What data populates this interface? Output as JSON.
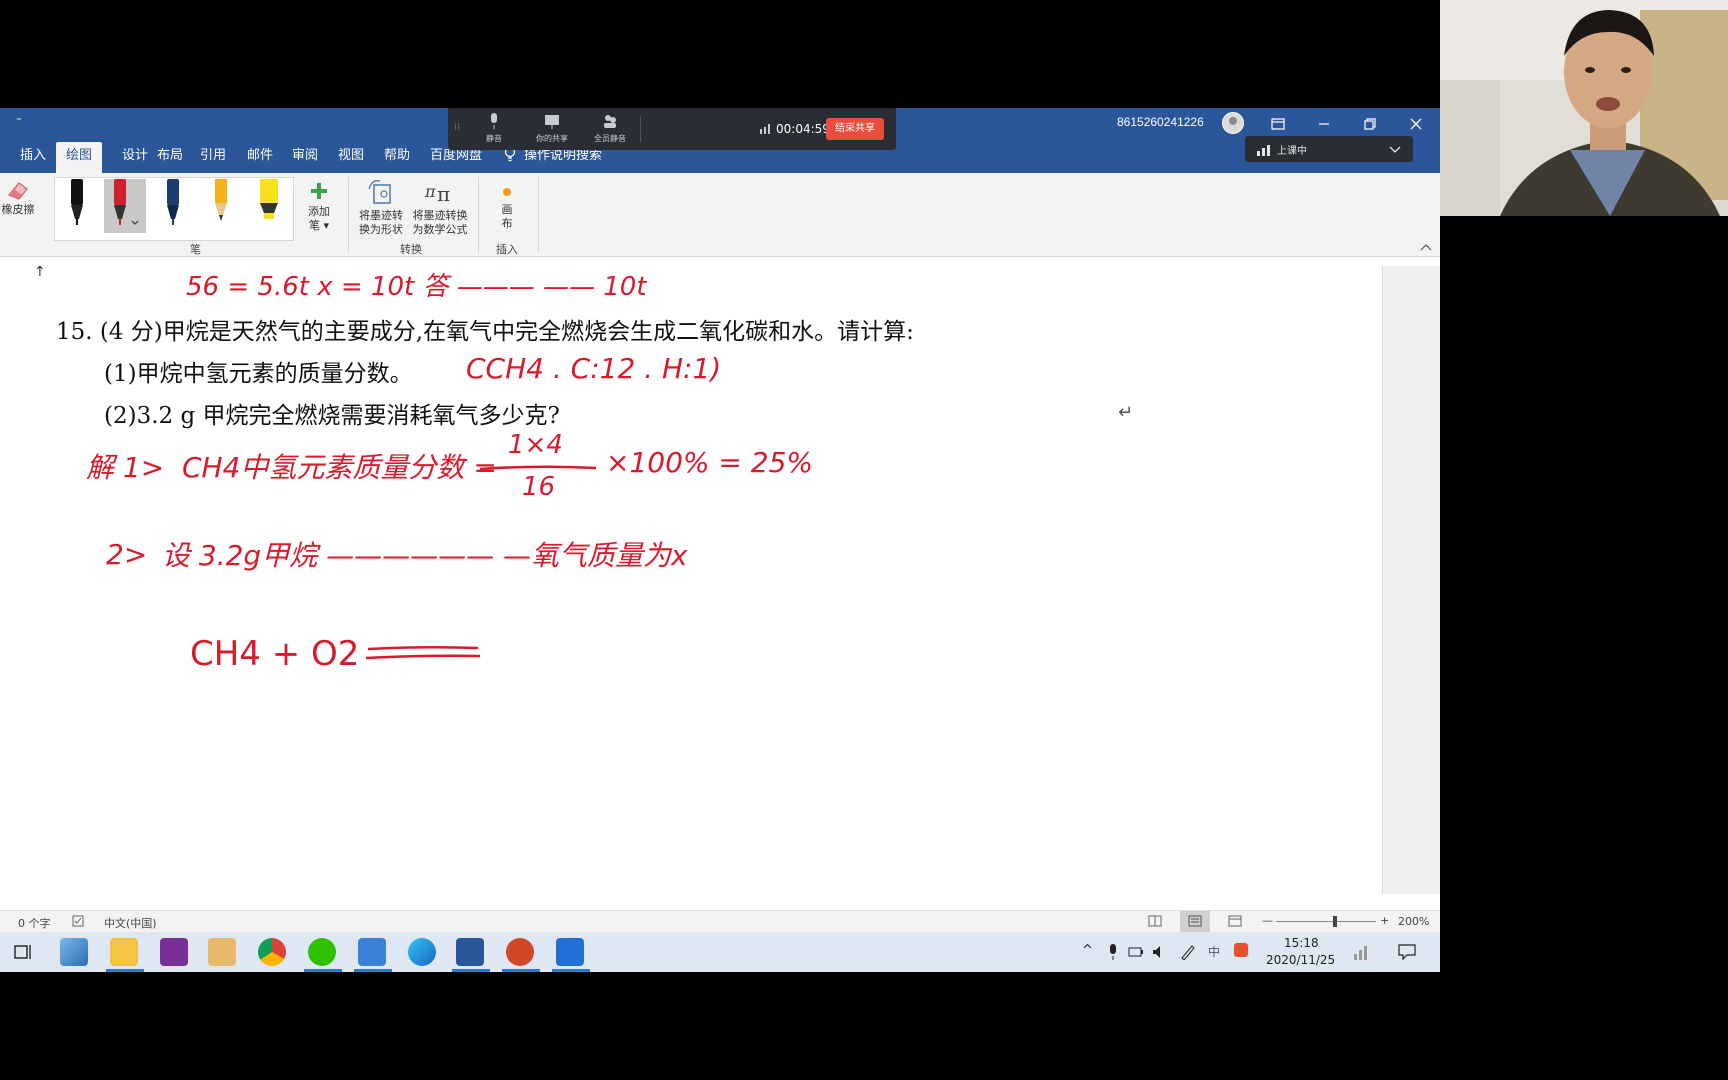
{
  "window": {
    "qat": "⁼",
    "account": "8615260241226"
  },
  "tabs": [
    {
      "label": "插入"
    },
    {
      "label": "绘图"
    },
    {
      "label": "设计"
    },
    {
      "label": "布局"
    },
    {
      "label": "引用"
    },
    {
      "label": "邮件"
    },
    {
      "label": "审阅"
    },
    {
      "label": "视图"
    },
    {
      "label": "帮助"
    },
    {
      "label": "百度网盘"
    }
  ],
  "tellme": "操作说明搜索",
  "ribbon": {
    "eraser": "橡皮擦",
    "add_pen_1": "添加",
    "add_pen_2": "笔 ▾",
    "convert_shape_1": "将墨迹转",
    "convert_shape_2": "换为形状",
    "convert_math_1": "将墨迹转换",
    "convert_math_2": "为数学公式",
    "canvas_1": "画",
    "canvas_2": "布",
    "group_pens": "笔",
    "group_convert": "转换",
    "group_insert": "插入"
  },
  "meeting": {
    "mute_label": "静音",
    "share_label": "你的共享",
    "mute_all_label": "全员静音",
    "timer": "00:04:59",
    "end_share": "结束共享",
    "class_status": "上课中"
  },
  "document": {
    "top_strip_ink": "56 = 5.6t      x = 10t   答 ——— ——  10t",
    "question_line": "15. (4 分)甲烷是天然气的主要成分,在氧气中完全燃烧会生成二氧化碳和水。请计算:",
    "sub1": "(1)甲烷中氢元素的质量分数。",
    "sub2": "(2)3.2 g 甲烷完全燃烧需要消耗氧气多少克?",
    "para_mark": "↵",
    "ink": {
      "sub1_tail": "CCH4  .  C:12 . H:1)",
      "solve_label": "解 1>",
      "solve_text": "CH4中氢元素质量分数 =",
      "frac_num": "1×4",
      "frac_den": "16",
      "frac_tail": "×100%  =  25%",
      "step2_label": "2>",
      "step2_text": "设 3.2g甲烷 —————— —氧气质量为x",
      "equation": "CH4  +  O2"
    }
  },
  "status": {
    "word_count": "0 个字",
    "language": "中文(中国)",
    "zoom_minus": "—",
    "zoom_plus": "+",
    "zoom": "200%"
  },
  "taskbar": {
    "time": "15:18",
    "date": "2020/11/25"
  }
}
